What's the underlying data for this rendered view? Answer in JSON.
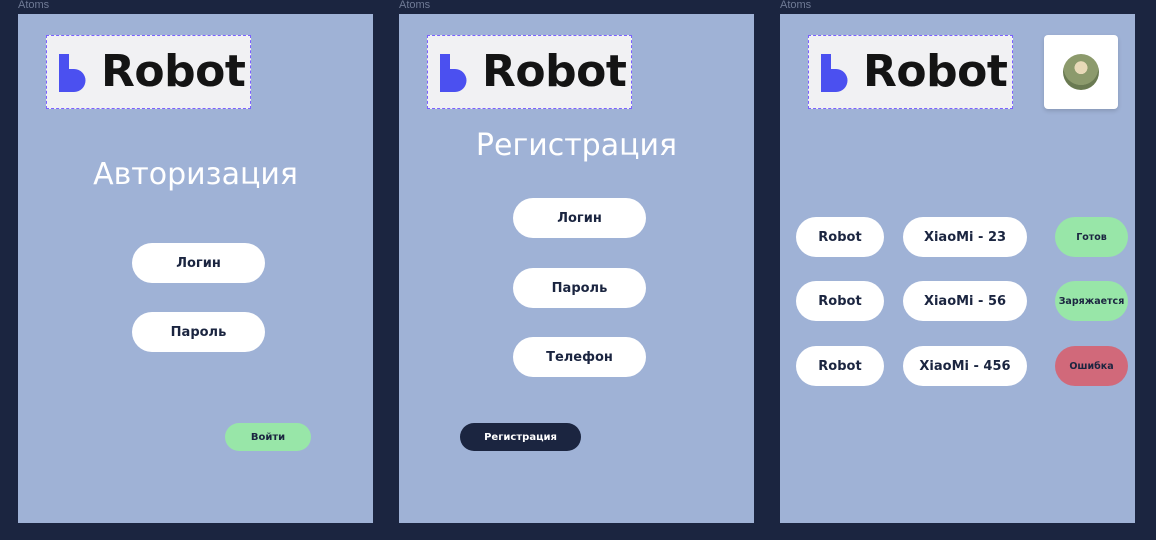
{
  "frame_label": "Atoms",
  "logo": {
    "text": "Robot",
    "color": "#4b50f0"
  },
  "login_screen": {
    "title": "Авторизация",
    "fields": [
      "Логин",
      "Пароль"
    ],
    "submit_label": "Войти"
  },
  "register_screen": {
    "title": "Регистрация",
    "fields": [
      "Логин",
      "Пароль",
      "Телефон"
    ],
    "submit_label": "Регистрация"
  },
  "robots_screen": {
    "rows": [
      {
        "name": "Robot",
        "model": "XiaoMi - 23",
        "status": "Готов",
        "status_color": "#98e6a8"
      },
      {
        "name": "Robot",
        "model": "XiaoMi - 56",
        "status": "Заряжается",
        "status_color": "#98e6a8"
      },
      {
        "name": "Robot",
        "model": "XiaoMi - 456",
        "status": "Ошибка",
        "status_color": "#d1697a"
      }
    ]
  },
  "colors": {
    "background": "#1b2540",
    "frame": "#9fb2d6",
    "accent": "#4b50f0"
  }
}
